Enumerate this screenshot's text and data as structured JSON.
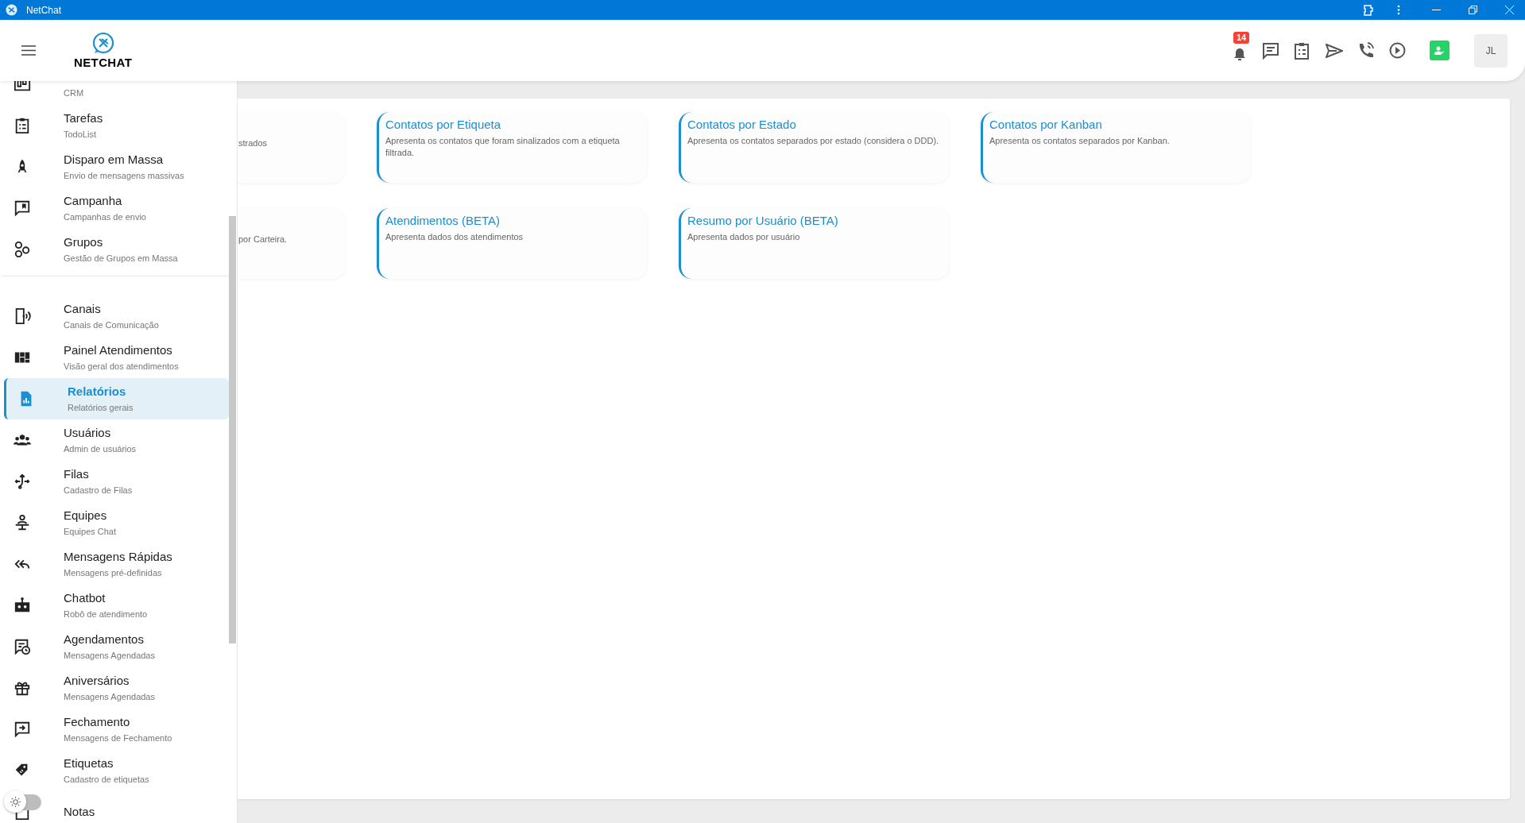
{
  "window": {
    "title": "NetChat"
  },
  "header": {
    "logo_text": "NETCHAT",
    "notification_count": "14",
    "avatar_initials": "JL"
  },
  "sidebar": {
    "sections": [
      [
        {
          "subtitle": "CRM",
          "selected": false
        },
        {
          "title": "Tarefas",
          "subtitle": "TodoList",
          "selected": false
        },
        {
          "title": "Disparo em Massa",
          "subtitle": "Envio de mensagens massivas",
          "selected": false
        },
        {
          "title": "Campanha",
          "subtitle": "Campanhas de envio",
          "selected": false
        },
        {
          "title": "Grupos",
          "subtitle": "Gestão de Grupos em Massa",
          "selected": false
        }
      ],
      [
        {
          "title": "Canais",
          "subtitle": "Canais de Comunicação",
          "selected": false
        },
        {
          "title": "Painel Atendimentos",
          "subtitle": "Visão geral dos atendimentos",
          "selected": false
        },
        {
          "title": "Relatórios",
          "subtitle": "Relatórios gerais",
          "selected": true
        },
        {
          "title": "Usuários",
          "subtitle": "Admin de usuários",
          "selected": false
        },
        {
          "title": "Filas",
          "subtitle": "Cadastro de Filas",
          "selected": false
        },
        {
          "title": "Equipes",
          "subtitle": "Equipes Chat",
          "selected": false
        },
        {
          "title": "Mensagens Rápidas",
          "subtitle": "Mensagens pré-definidas",
          "selected": false
        },
        {
          "title": "Chatbot",
          "subtitle": "Robô de atendimento",
          "selected": false
        },
        {
          "title": "Agendamentos",
          "subtitle": "Mensagens Agendadas",
          "selected": false
        },
        {
          "title": "Aniversários",
          "subtitle": "Mensagens Agendadas",
          "selected": false
        },
        {
          "title": "Fechamento",
          "subtitle": "Mensagens de Fechamento",
          "selected": false
        },
        {
          "title": "Etiquetas",
          "subtitle": "Cadastro de etiquetas",
          "selected": false
        },
        {
          "title": "Notas",
          "selected": false
        }
      ]
    ],
    "theme_switch": {
      "on": false
    }
  },
  "reports": [
    {
      "description": "strados"
    },
    {
      "title": "Contatos por Etiqueta",
      "description": "Apresenta os contatos que foram sinalizados com a etiqueta filtrada."
    },
    {
      "title": "Contatos por Estado",
      "description": "Apresenta os contatos separados por estado (considera o DDD)."
    },
    {
      "title": "Contatos por Kanban",
      "description": "Apresenta os contatos separados por Kanban."
    },
    {
      "description": "por Carteira."
    },
    {
      "title": "Atendimentos (BETA)",
      "description": "Apresenta dados dos atendimentos"
    },
    {
      "title": "Resumo por Usuário (BETA)",
      "description": "Apresenta dados por usuário"
    }
  ]
}
